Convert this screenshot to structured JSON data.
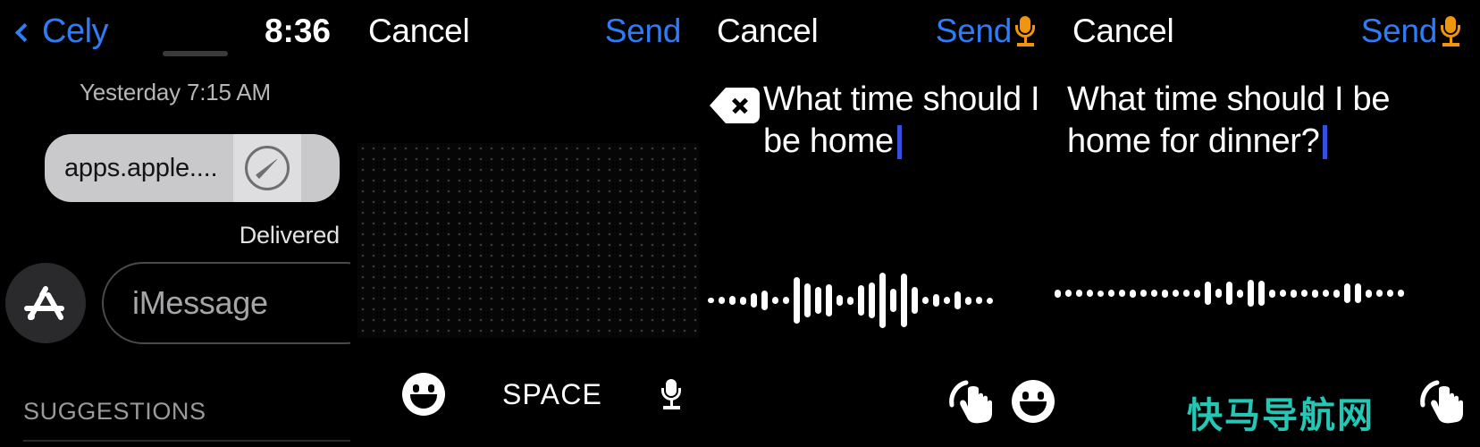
{
  "meta": {
    "device": "Apple Watch",
    "screen_count": 4,
    "accent_blue": "#2f7cf6",
    "mic_orange": "#f0960e",
    "caret_blue": "#3550e0",
    "watermark_teal": "#24c7b5"
  },
  "panel1": {
    "back_label": "Cely",
    "time": "8:36",
    "day_separator": "Yesterday 7:15 AM",
    "bubble_text": "apps.apple....",
    "bubble_icon": "safari-compass-icon",
    "delivered_label": "Delivered",
    "appstore_icon": "app-store-icon",
    "input_placeholder": "iMessage",
    "suggestions_label": "SUGGESTIONS"
  },
  "panel2": {
    "cancel_label": "Cancel",
    "send_label": "Send",
    "pad_type": "scribble-pad",
    "emoji_label": "emoji-smiley-icon",
    "space_label": "SPACE",
    "mic_label": "microphone-icon"
  },
  "panel3": {
    "cancel_label": "Cancel",
    "send_label": "Send",
    "send_mic_icon": "microphone-icon",
    "backspace_label": "backspace-delete-icon",
    "dictated_text": "What time should I be home",
    "waveform": [
      6,
      8,
      10,
      9,
      16,
      22,
      8,
      8,
      52,
      38,
      30,
      36,
      12,
      9,
      34,
      40,
      62,
      26,
      60,
      30,
      8,
      14,
      8,
      20,
      9,
      8,
      7
    ],
    "hand_icon": "tap-hand-icon",
    "emoji_label": "emoji-smiley-icon"
  },
  "panel4": {
    "cancel_label": "Cancel",
    "send_label": "Send",
    "send_mic_icon": "microphone-icon",
    "dictated_text": "What time should I be home for dinner?",
    "waveform": [
      9,
      8,
      8,
      8,
      7,
      8,
      8,
      9,
      8,
      8,
      9,
      8,
      8,
      9,
      26,
      10,
      26,
      9,
      30,
      28,
      9,
      8,
      9,
      8,
      9,
      8,
      9,
      22,
      22,
      9,
      8,
      8,
      8
    ],
    "hand_icon": "tap-hand-icon",
    "watermark": "快马导航网"
  }
}
